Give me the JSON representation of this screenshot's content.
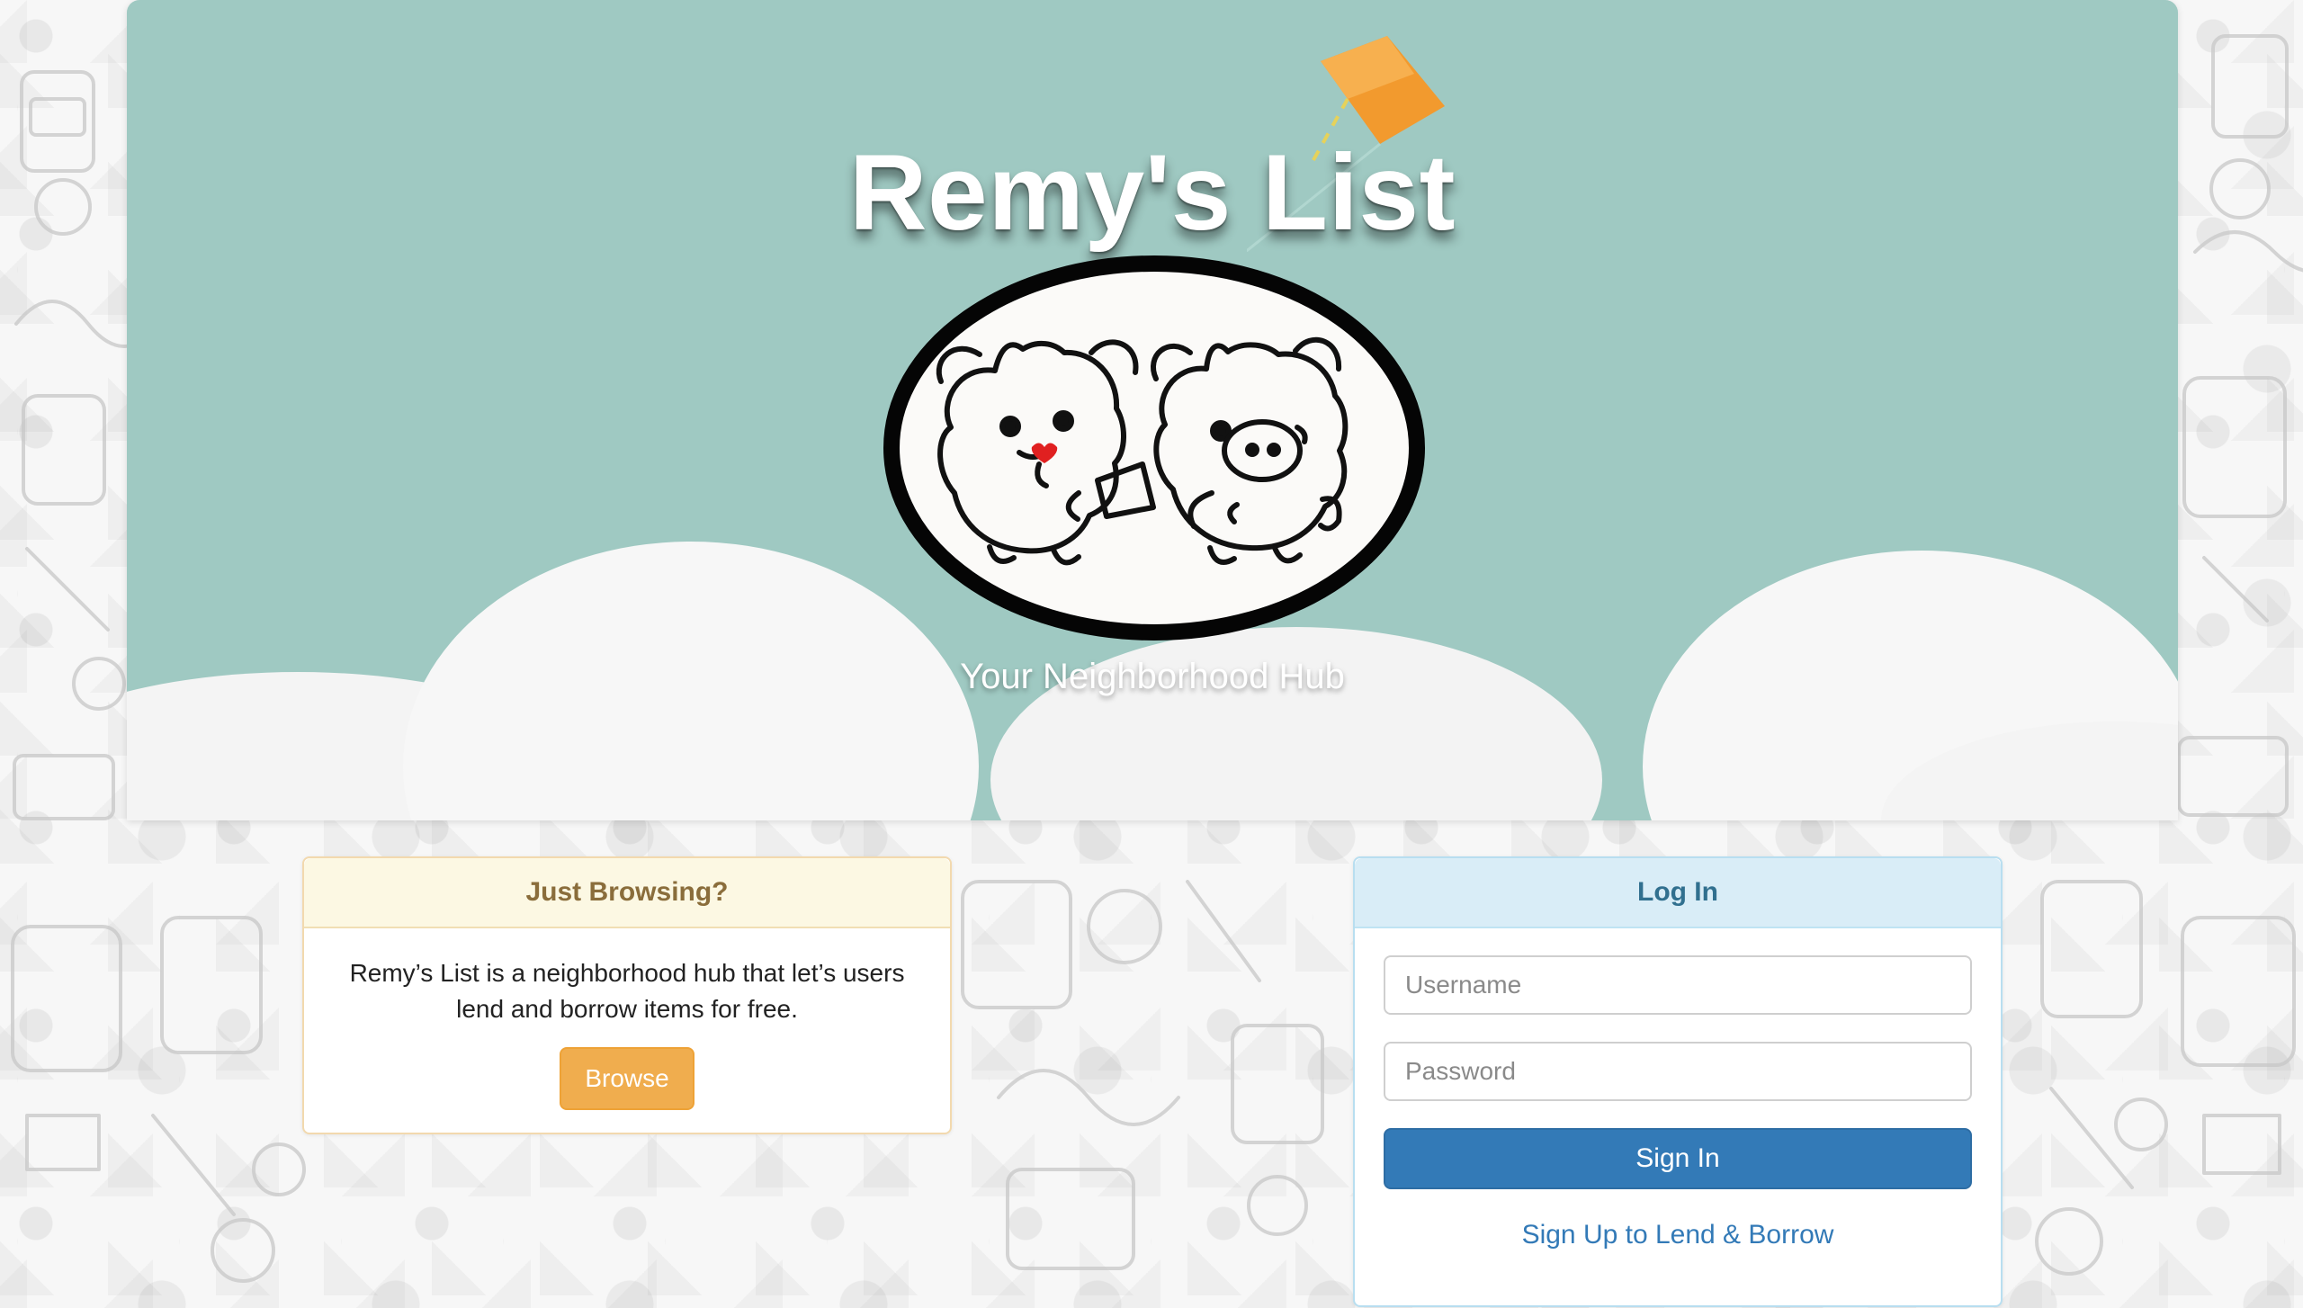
{
  "hero": {
    "title": "Remy's List",
    "subtitle": "Your Neighborhood Hub",
    "background_color": "#9fc9c2",
    "kite_color": "#f0a33a"
  },
  "browse": {
    "heading": "Just Browsing?",
    "description": "Remy’s List is a neighborhood hub that let’s users lend and borrow items for free.",
    "button_label": "Browse",
    "button_color": "#f0ad4e"
  },
  "login": {
    "heading": "Log In",
    "username_placeholder": "Username",
    "password_placeholder": "Password",
    "signin_label": "Sign In",
    "signup_label": "Sign Up to Lend & Borrow",
    "primary_color": "#337ab7",
    "panel_color": "#d9edf7"
  }
}
